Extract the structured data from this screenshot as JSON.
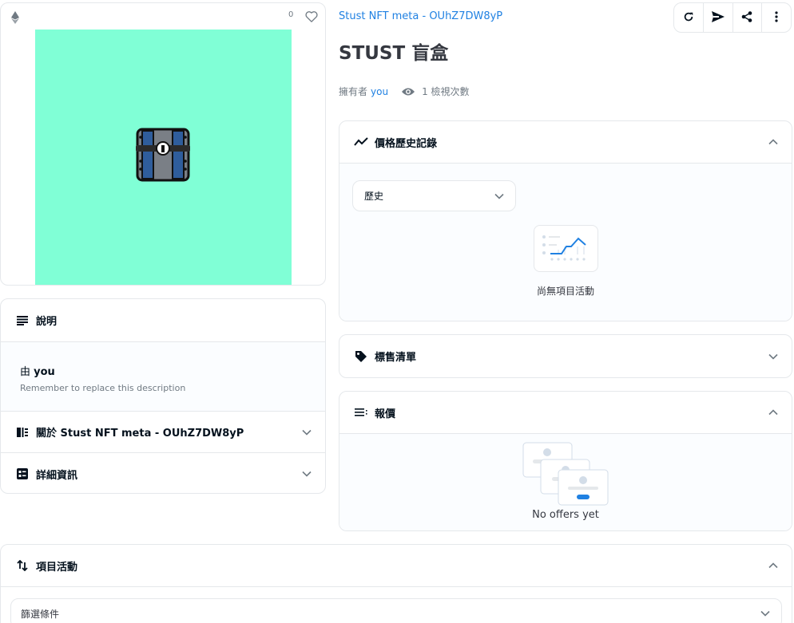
{
  "image_card": {
    "favorite_count": "0",
    "chain_icon": "ethereum-icon",
    "favorite_icon": "heart-icon",
    "background_color": "#80ffd6"
  },
  "collection_link": "Stust NFT meta - OUhZ7DW8yP",
  "title": "STUST 盲盒",
  "owner": {
    "prefix": "擁有者",
    "name": "you"
  },
  "views": "1 檢視次數",
  "toolbar": {
    "refresh_icon": "refresh-icon",
    "transfer_icon": "send-icon",
    "share_icon": "share-icon",
    "more_icon": "more-vertical-icon"
  },
  "description_panel": {
    "title": "說明",
    "by_prefix": "由",
    "by_name": "you",
    "text": "Remember to replace this description"
  },
  "about_panel": {
    "title": "關於 Stust NFT meta - OUhZ7DW8yP"
  },
  "details_panel": {
    "title": "詳細資訊"
  },
  "price_history": {
    "title": "價格歷史記錄",
    "select_value": "歷史",
    "empty_text": "尚無項目活動"
  },
  "listings": {
    "title": "標售清單"
  },
  "offers": {
    "title": "報價",
    "empty_text": "No offers yet"
  },
  "item_activity": {
    "title": "項目活動",
    "filter_placeholder": "篩選條件"
  },
  "colors": {
    "accent": "#2081e2",
    "text": "#04111d",
    "border": "#e5e8eb",
    "muted": "#707a83"
  }
}
